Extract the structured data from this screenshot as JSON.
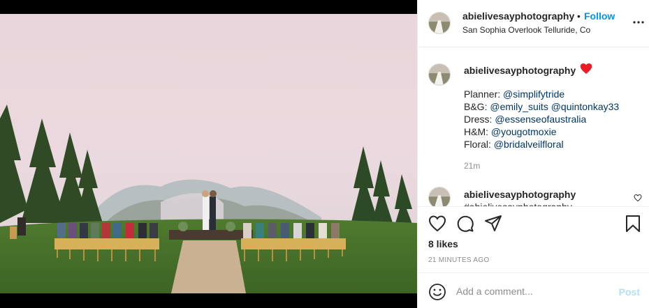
{
  "post": {
    "username": "abielivesayphotography",
    "dot": "•",
    "follow_label": "Follow",
    "location": "San Sophia Overlook Telluride, Co",
    "more_icon": "more-options-icon"
  },
  "caption": {
    "username": "abielivesayphotography",
    "heart_emoji": "red-heart-icon",
    "lines": [
      {
        "label": "Planner: ",
        "mentions": "@simplifytride"
      },
      {
        "label": "B&G: ",
        "mentions": "@emily_suits @quintonkay33"
      },
      {
        "label": "Dress: ",
        "mentions": "@essenseofaustralia"
      },
      {
        "label": "H&M: ",
        "mentions": "@yougotmoxie"
      },
      {
        "label": "Floral: ",
        "mentions": "@bridalveilfloral"
      }
    ],
    "time": "21m"
  },
  "comment2": {
    "username": "abielivesayphotography",
    "text": "#abielivesayphotography"
  },
  "likes": "8 likes",
  "post_time": "21 MINUTES AGO",
  "add_comment": {
    "placeholder": "Add a comment...",
    "post_label": "Post"
  },
  "colors": {
    "link": "#0095f6",
    "mention": "#00376b",
    "muted": "#8e8e8e",
    "post_disabled": "#b2dffc",
    "heart": "#ed1c24"
  }
}
